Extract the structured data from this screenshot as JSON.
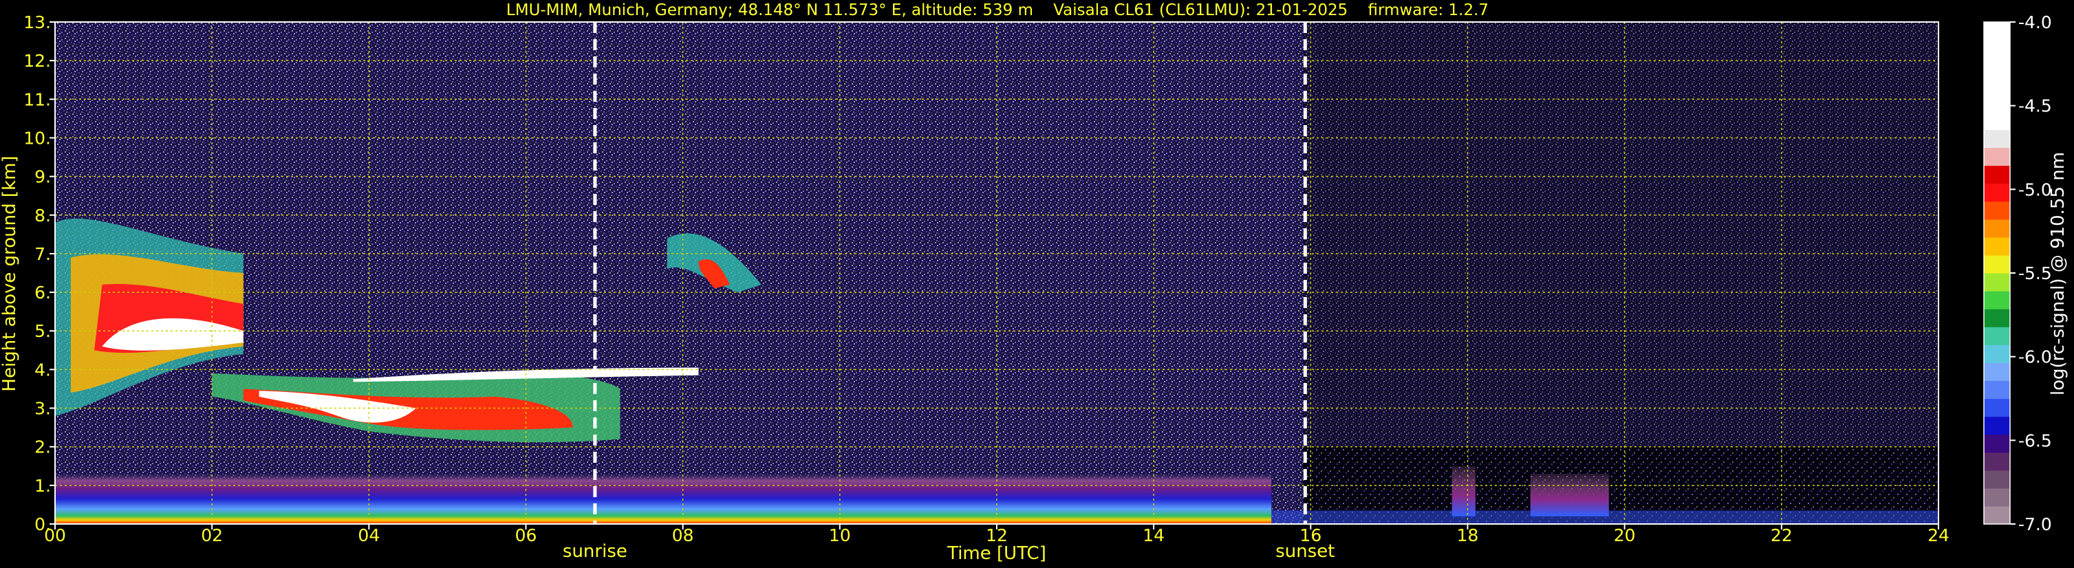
{
  "chart_data": {
    "type": "heatmap",
    "title": "LMU-MIM, Munich, Germany; 48.148° N 11.573° E, altitude: 539 m    Vaisala CL61 (CL61LMU): 21-01-2025    firmware: 1.2.7",
    "xlabel": "Time [UTC]",
    "ylabel": "Height above ground [km]",
    "xlim": [
      0,
      24
    ],
    "ylim": [
      0,
      13
    ],
    "x_ticks": [
      "00",
      "02",
      "04",
      "06",
      "08",
      "10",
      "12",
      "14",
      "16",
      "18",
      "20",
      "22",
      "24"
    ],
    "y_ticks": [
      "0.",
      "1.",
      "2.",
      "3.",
      "4.",
      "5.",
      "6.",
      "7.",
      "8.",
      "9.",
      "10.",
      "11.",
      "12.",
      "13."
    ],
    "grid": true,
    "annotations": [
      {
        "label": "sunrise",
        "time": 6.88
      },
      {
        "label": "sunset",
        "time": 15.93
      }
    ],
    "colorbar": {
      "label": "log(rc-signal) @ 910.55 nm",
      "range": [
        -7.0,
        -4.0
      ],
      "ticks": [
        "-4.0",
        "-4.5",
        "-5.0",
        "-5.5",
        "-6.0",
        "-6.5",
        "-7.0"
      ],
      "colors": [
        "#a48c9c",
        "#8a6e86",
        "#6d4d70",
        "#5a2a68",
        "#3a0a80",
        "#1010c8",
        "#3050f0",
        "#5a82f8",
        "#7aa8fb",
        "#5ec8e0",
        "#40c8a0",
        "#109030",
        "#40d040",
        "#a0e830",
        "#f0f020",
        "#ffc000",
        "#ff9000",
        "#ff5000",
        "#ff1010",
        "#e00000",
        "#f0b0b0",
        "#e8e8e8",
        "#ffffff",
        "#ffffff",
        "#ffffff",
        "#ffffff",
        "#ffffff",
        "#ffffff"
      ]
    },
    "features": [
      {
        "name": "noise background",
        "start": 0,
        "end": 24,
        "bottom": 0,
        "top": 13
      },
      {
        "name": "boundary layer",
        "start": 0,
        "end": 15.5,
        "bottom": 0,
        "top": 1.3
      },
      {
        "name": "cirrus",
        "start": 0,
        "end": 2.4,
        "bottom": 2.8,
        "top": 8.2
      },
      {
        "name": "mid-level cloud",
        "start": 2.0,
        "end": 7.2,
        "bottom": 2.0,
        "top": 4.0
      },
      {
        "name": "cloud top layer",
        "start": 3.8,
        "end": 8.2,
        "bottom": 3.7,
        "top": 4.1
      },
      {
        "name": "cirrus",
        "start": 7.8,
        "end": 9.0,
        "bottom": 6.0,
        "top": 7.7
      },
      {
        "name": "aerosol plume",
        "start": 17.8,
        "end": 18.1,
        "bottom": 0.2,
        "top": 1.5
      },
      {
        "name": "aerosol plume",
        "start": 18.8,
        "end": 19.8,
        "bottom": 0.2,
        "top": 1.3
      }
    ]
  }
}
